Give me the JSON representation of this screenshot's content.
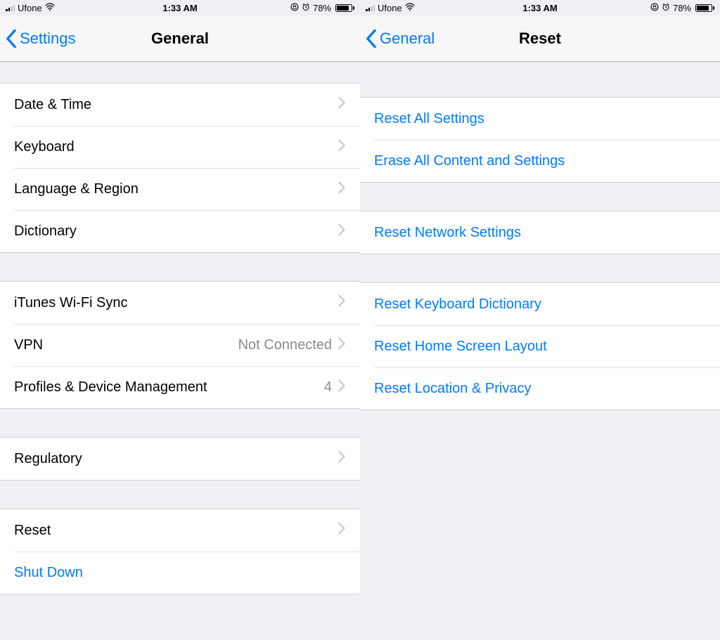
{
  "status": {
    "carrier": "Ufone",
    "time": "1:33 AM",
    "battery": "78%"
  },
  "left": {
    "back": "Settings",
    "title": "General",
    "groups": [
      {
        "rows": [
          {
            "label": "Date & Time",
            "type": "disclosure"
          },
          {
            "label": "Keyboard",
            "type": "disclosure"
          },
          {
            "label": "Language & Region",
            "type": "disclosure"
          },
          {
            "label": "Dictionary",
            "type": "disclosure"
          }
        ]
      },
      {
        "rows": [
          {
            "label": "iTunes Wi-Fi Sync",
            "type": "disclosure"
          },
          {
            "label": "VPN",
            "detail": "Not Connected",
            "type": "disclosure"
          },
          {
            "label": "Profiles & Device Management",
            "detail": "4",
            "type": "disclosure"
          }
        ]
      },
      {
        "rows": [
          {
            "label": "Regulatory",
            "type": "disclosure"
          }
        ]
      },
      {
        "rows": [
          {
            "label": "Reset",
            "type": "disclosure"
          },
          {
            "label": "Shut Down",
            "type": "action"
          }
        ]
      }
    ]
  },
  "right": {
    "back": "General",
    "title": "Reset",
    "groups": [
      {
        "rows": [
          {
            "label": "Reset All Settings",
            "type": "action"
          },
          {
            "label": "Erase All Content and Settings",
            "type": "action"
          }
        ]
      },
      {
        "rows": [
          {
            "label": "Reset Network Settings",
            "type": "action"
          }
        ]
      },
      {
        "rows": [
          {
            "label": "Reset Keyboard Dictionary",
            "type": "action"
          },
          {
            "label": "Reset Home Screen Layout",
            "type": "action"
          },
          {
            "label": "Reset Location & Privacy",
            "type": "action"
          }
        ]
      }
    ]
  }
}
